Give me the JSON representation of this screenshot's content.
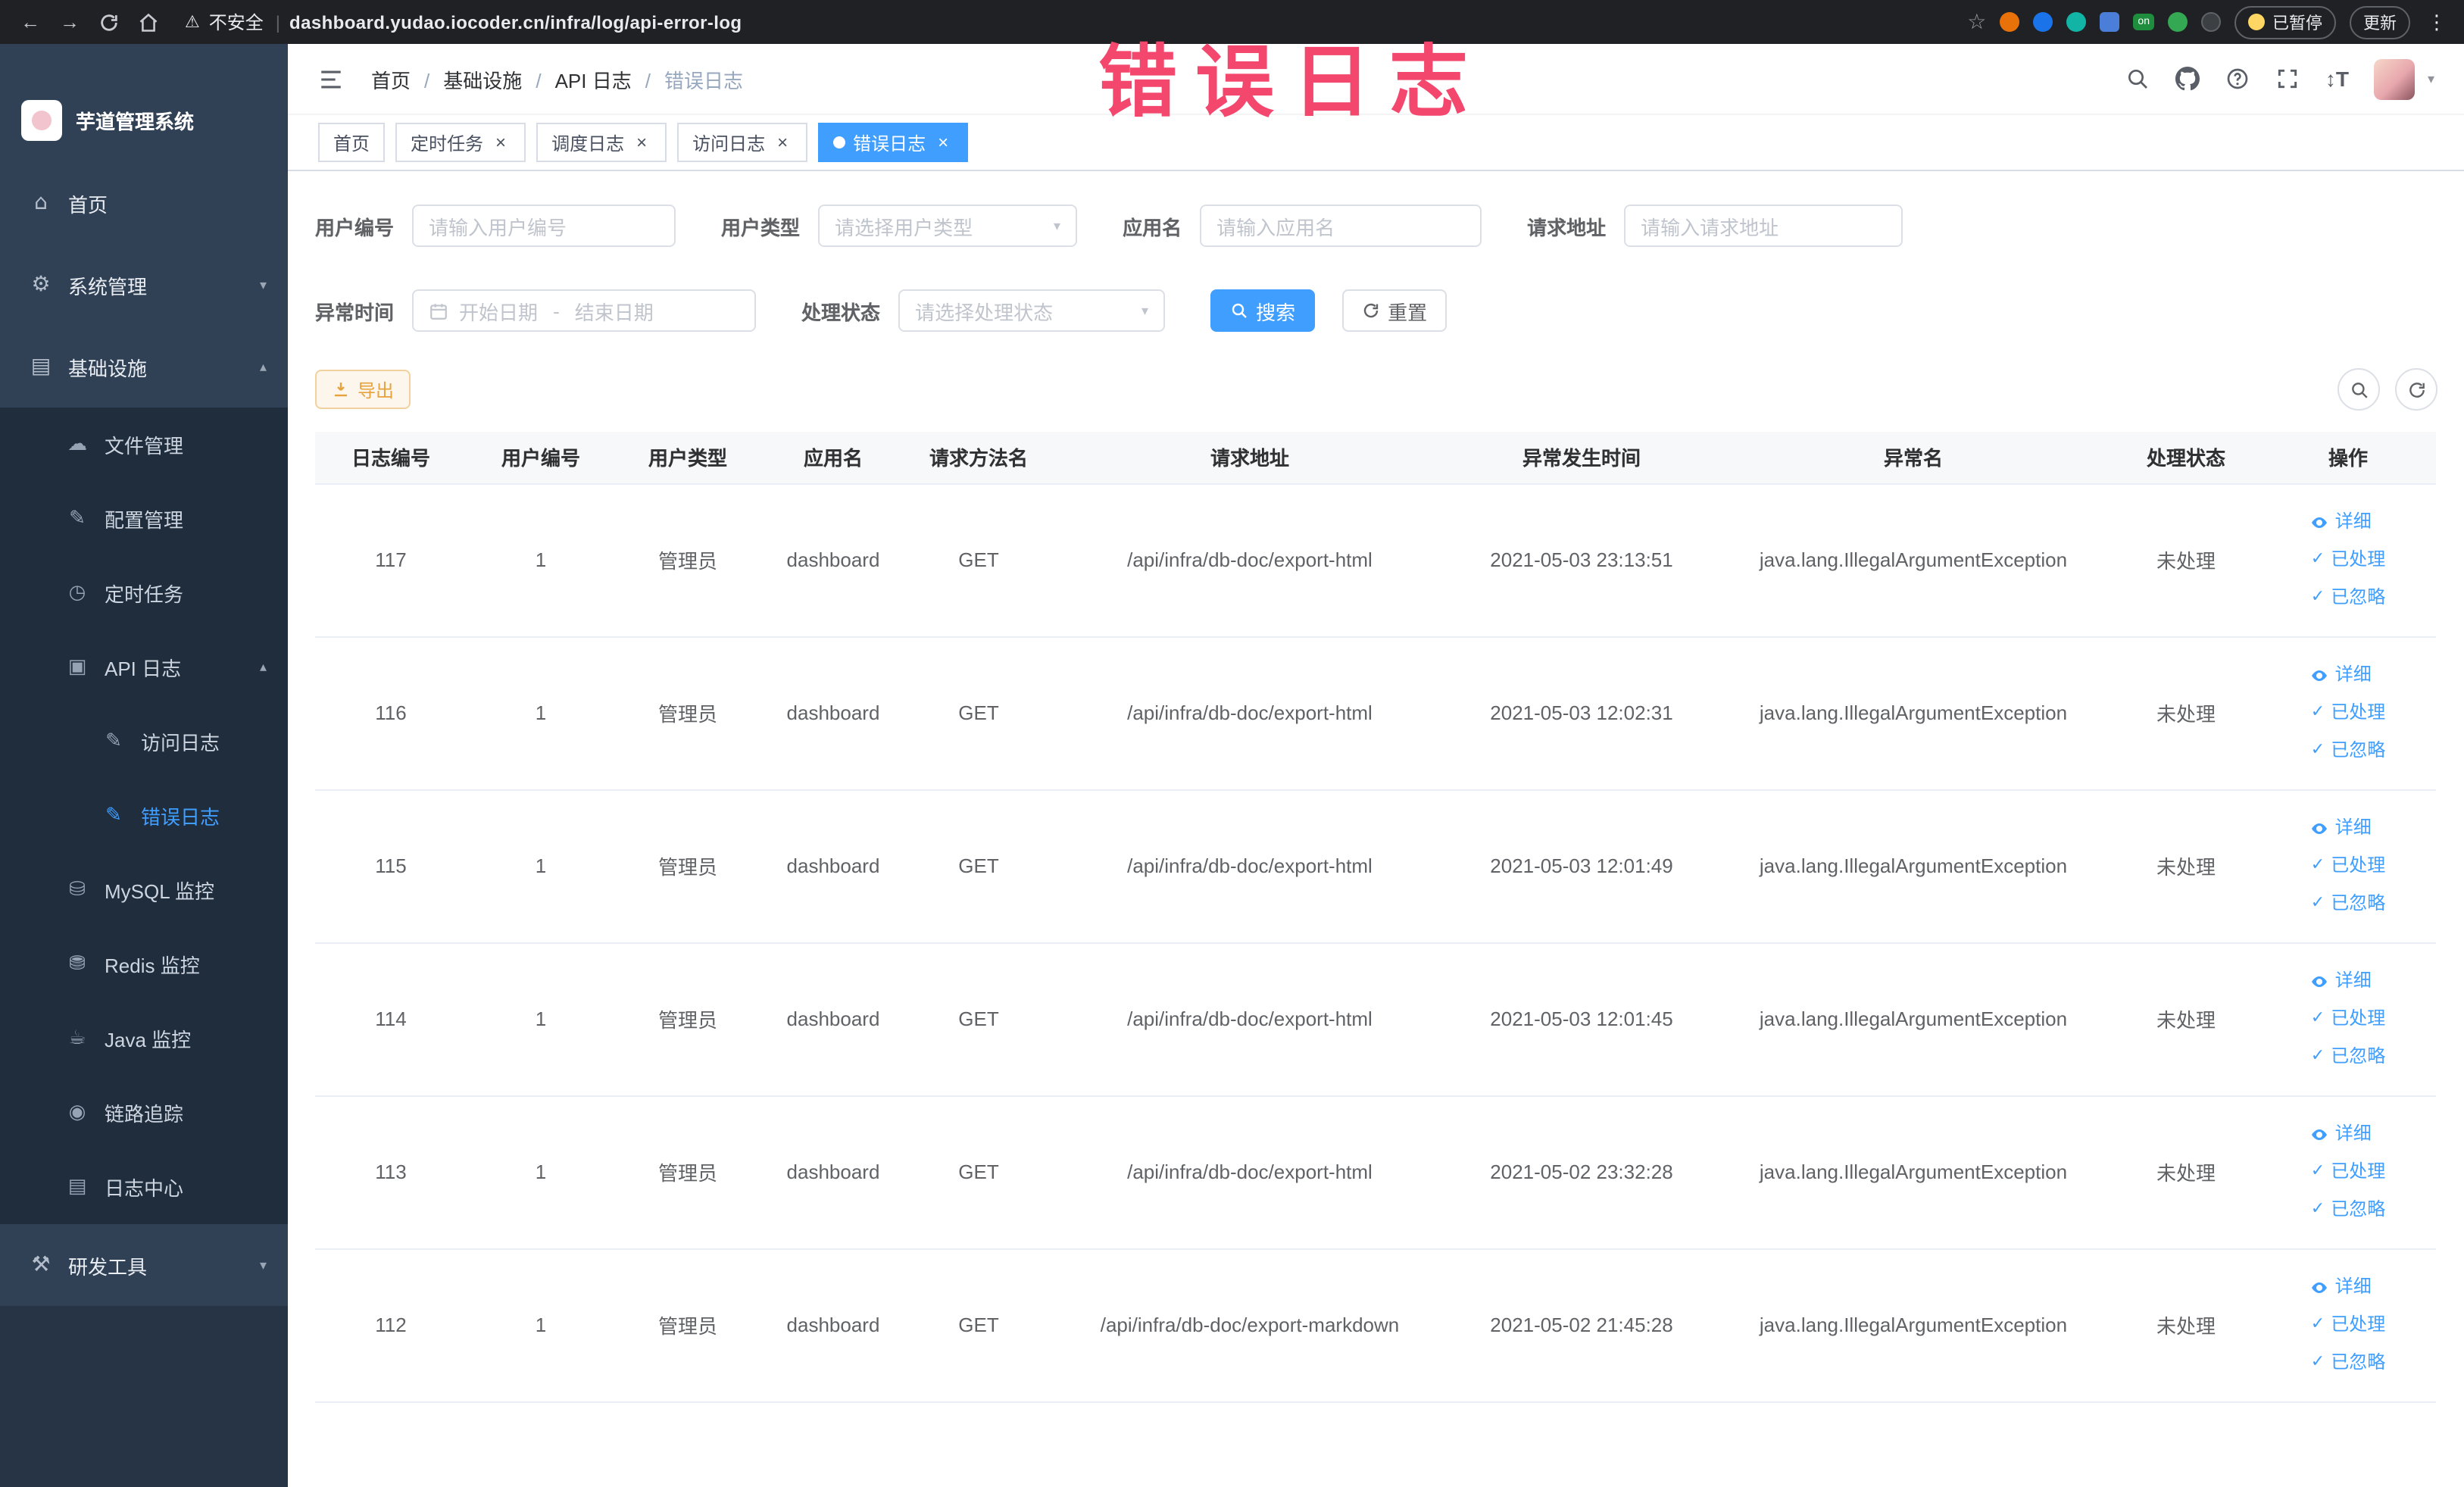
{
  "browser": {
    "security_label": "不安全",
    "url": "dashboard.yudao.iocoder.cn/infra/log/api-error-log",
    "ext_on_label": "on",
    "paused_label": "已暂停",
    "update_label": "更新"
  },
  "sidebar": {
    "title": "芋道管理系统",
    "items": [
      {
        "key": "home",
        "label": "首页",
        "icon": "home"
      },
      {
        "key": "system",
        "label": "系统管理",
        "icon": "gear",
        "expandable": true,
        "expanded": false
      },
      {
        "key": "infra",
        "label": "基础设施",
        "icon": "infra",
        "expandable": true,
        "expanded": true,
        "children": [
          {
            "key": "file",
            "label": "文件管理",
            "icon": "file"
          },
          {
            "key": "config",
            "label": "配置管理",
            "icon": "config"
          },
          {
            "key": "job",
            "label": "定时任务",
            "icon": "timer"
          },
          {
            "key": "api-log",
            "label": "API 日志",
            "icon": "api-log",
            "expandable": true,
            "expanded": true,
            "children": [
              {
                "key": "access-log",
                "label": "访问日志",
                "icon": "doc"
              },
              {
                "key": "error-log",
                "label": "错误日志",
                "icon": "doc",
                "active": true
              }
            ]
          },
          {
            "key": "mysql",
            "label": "MySQL 监控",
            "icon": "mysql"
          },
          {
            "key": "redis",
            "label": "Redis 监控",
            "icon": "redis"
          },
          {
            "key": "java",
            "label": "Java 监控",
            "icon": "java"
          },
          {
            "key": "trace",
            "label": "链路追踪",
            "icon": "trace"
          },
          {
            "key": "log-center",
            "label": "日志中心",
            "icon": "log-center"
          }
        ]
      },
      {
        "key": "dev-tools",
        "label": "研发工具",
        "icon": "tools",
        "expandable": true,
        "expanded": false
      }
    ]
  },
  "header": {
    "breadcrumb": [
      "首页",
      "基础设施",
      "API 日志",
      "错误日志"
    ]
  },
  "annotation": {
    "text": "错误日志",
    "color": "#F3476D"
  },
  "tabs": [
    {
      "key": "home",
      "label": "首页",
      "closable": false,
      "active": false
    },
    {
      "key": "job",
      "label": "定时任务",
      "closable": true,
      "active": false
    },
    {
      "key": "job-log",
      "label": "调度日志",
      "closable": true,
      "active": false
    },
    {
      "key": "access-log",
      "label": "访问日志",
      "closable": true,
      "active": false
    },
    {
      "key": "error-log",
      "label": "错误日志",
      "closable": true,
      "active": true
    }
  ],
  "filters": {
    "user_id": {
      "label": "用户编号",
      "placeholder": "请输入用户编号"
    },
    "user_type": {
      "label": "用户类型",
      "placeholder": "请选择用户类型"
    },
    "app_name": {
      "label": "应用名",
      "placeholder": "请输入应用名"
    },
    "request_url": {
      "label": "请求地址",
      "placeholder": "请输入请求地址"
    },
    "exception_time": {
      "label": "异常时间",
      "start_placeholder": "开始日期",
      "separator": "-",
      "end_placeholder": "结束日期"
    },
    "process_status": {
      "label": "处理状态",
      "placeholder": "请选择处理状态"
    },
    "search_label": "搜索",
    "reset_label": "重置"
  },
  "toolbar": {
    "export_label": "导出"
  },
  "table": {
    "columns": [
      "日志编号",
      "用户编号",
      "用户类型",
      "应用名",
      "请求方法名",
      "请求地址",
      "异常发生时间",
      "异常名",
      "处理状态",
      "操作"
    ],
    "rows": [
      {
        "id": "117",
        "user_id": "1",
        "user_type": "管理员",
        "app": "dashboard",
        "method": "GET",
        "url": "/api/infra/db-doc/export-html",
        "time": "2021-05-03 23:13:51",
        "exception": "java.lang.IllegalArgumentException",
        "status": "未处理"
      },
      {
        "id": "116",
        "user_id": "1",
        "user_type": "管理员",
        "app": "dashboard",
        "method": "GET",
        "url": "/api/infra/db-doc/export-html",
        "time": "2021-05-03 12:02:31",
        "exception": "java.lang.IllegalArgumentException",
        "status": "未处理"
      },
      {
        "id": "115",
        "user_id": "1",
        "user_type": "管理员",
        "app": "dashboard",
        "method": "GET",
        "url": "/api/infra/db-doc/export-html",
        "time": "2021-05-03 12:01:49",
        "exception": "java.lang.IllegalArgumentException",
        "status": "未处理"
      },
      {
        "id": "114",
        "user_id": "1",
        "user_type": "管理员",
        "app": "dashboard",
        "method": "GET",
        "url": "/api/infra/db-doc/export-html",
        "time": "2021-05-03 12:01:45",
        "exception": "java.lang.IllegalArgumentException",
        "status": "未处理"
      },
      {
        "id": "113",
        "user_id": "1",
        "user_type": "管理员",
        "app": "dashboard",
        "method": "GET",
        "url": "/api/infra/db-doc/export-html",
        "time": "2021-05-02 23:32:28",
        "exception": "java.lang.IllegalArgumentException",
        "status": "未处理"
      },
      {
        "id": "112",
        "user_id": "1",
        "user_type": "管理员",
        "app": "dashboard",
        "method": "GET",
        "url": "/api/infra/db-doc/export-markdown",
        "time": "2021-05-02 21:45:28",
        "exception": "java.lang.IllegalArgumentException",
        "status": "未处理"
      }
    ],
    "actions": [
      {
        "key": "detail",
        "label": "详细",
        "icon": "eye"
      },
      {
        "key": "processed",
        "label": "已处理",
        "icon": "check"
      },
      {
        "key": "ignored",
        "label": "已忽略",
        "icon": "check"
      }
    ]
  },
  "colors": {
    "primary": "#409EFF",
    "sidebar_bg": "#304156",
    "submenu_bg": "#1F2D3D",
    "warning": "#E6A23C"
  }
}
